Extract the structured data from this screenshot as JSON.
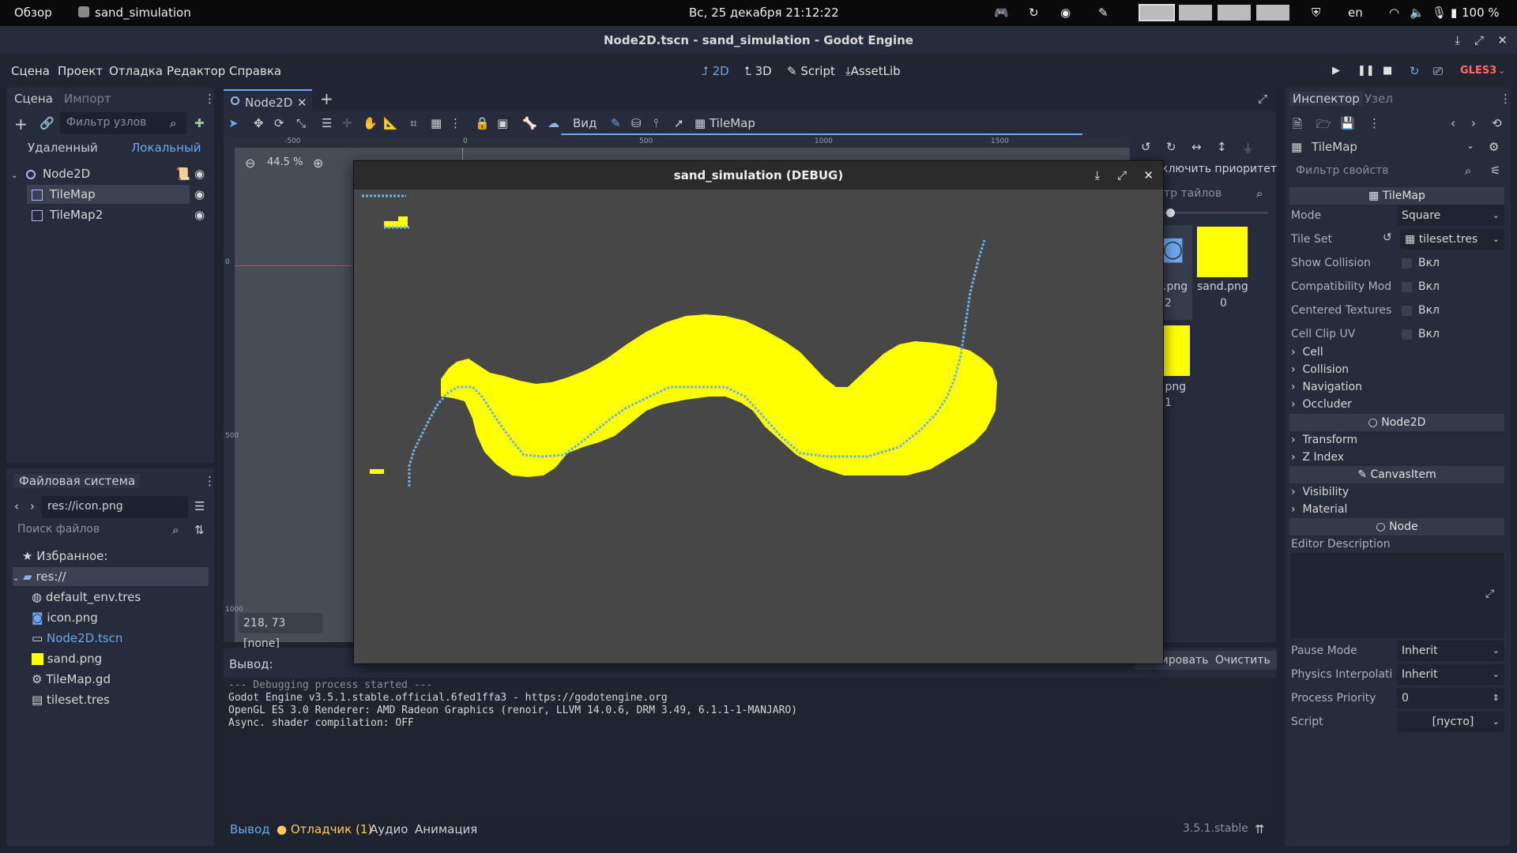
{
  "topbar": {
    "overview": "Обзор",
    "app_name": "sand_simulation",
    "datetime": "Вс, 25 декабря  21:12:22",
    "lang": "en",
    "battery": "100 %"
  },
  "window_title": "Node2D.tscn - sand_simulation - Godot Engine",
  "menu": {
    "items": [
      "Сцена",
      "Проект",
      "Отладка",
      "Редактор",
      "Справка"
    ],
    "modes": {
      "m2d": "2D",
      "m3d": "3D",
      "script": "Script",
      "assetlib": "AssetLib"
    },
    "renderer": "GLES3"
  },
  "scene_dock": {
    "tabs": {
      "scene": "Сцена",
      "import": "Импорт"
    },
    "filter_placeholder": "Фильтр узлов",
    "remote": "Удаленный",
    "local": "Локальный",
    "nodes": [
      "Node2D",
      "TileMap",
      "TileMap2"
    ]
  },
  "fs_dock": {
    "title": "Файловая система",
    "path": "res://icon.png",
    "search_placeholder": "Поиск файлов",
    "favorites": "Избранное:",
    "root": "res://",
    "files": [
      "default_env.tres",
      "icon.png",
      "Node2D.tscn",
      "sand.png",
      "TileMap.gd",
      "tileset.tres"
    ]
  },
  "editor": {
    "scene_tab": "Node2D",
    "zoom": "44.5 %",
    "view_menu": "Вид",
    "tilemap_label": "TileMap",
    "coords": "218, 73 [none]",
    "ruler_ticks": [
      "-500",
      "0",
      "500",
      "1000",
      "1500"
    ],
    "vruler_ticks": [
      "0",
      "500",
      "1000"
    ],
    "priority_label": "ключить приоритет",
    "tile_filter_placeholder": "тр тайлов",
    "tiles": [
      {
        "name": ".png",
        "idx": "2"
      },
      {
        "name": "sand.png",
        "idx": "0"
      },
      {
        "name": ".png",
        "idx": "1"
      }
    ]
  },
  "debug_window": {
    "title": "sand_simulation (DEBUG)"
  },
  "output": {
    "label": "Вывод:",
    "copy": "Копировать",
    "clear": "Очистить",
    "lines": [
      "--- Debugging process started ---",
      "Godot Engine v3.5.1.stable.official.6fed1ffa3 - https://godotengine.org",
      "OpenGL ES 3.0 Renderer: AMD Radeon Graphics (renoir, LLVM 14.0.6, DRM 3.49, 6.1.1-1-MANJARO)",
      "Async. shader compilation: OFF"
    ]
  },
  "bottom_tabs": {
    "output": "Вывод",
    "debugger": "Отладчик (1)",
    "audio": "Аудио",
    "animation": "Анимация",
    "version": "3.5.1.stable"
  },
  "inspector": {
    "tabs": {
      "inspector": "Инспектор",
      "node": "Узел"
    },
    "node_name": "TileMap",
    "filter_placeholder": "Фильтр свойств",
    "section_tilemap": "TileMap",
    "props": {
      "mode_label": "Mode",
      "mode_val": "Square",
      "tileset_label": "Tile Set",
      "tileset_val": "tileset.tres",
      "show_collision": "Show Collision",
      "compat": "Compatibility Mod",
      "centered": "Centered Textures",
      "clip": "Cell Clip UV",
      "on": "Вкл"
    },
    "groups1": [
      "Cell",
      "Collision",
      "Navigation",
      "Occluder"
    ],
    "section_node2d": "Node2D",
    "groups2": [
      "Transform",
      "Z Index"
    ],
    "section_canvas": "CanvasItem",
    "groups3": [
      "Visibility",
      "Material"
    ],
    "section_node": "Node",
    "editor_desc": "Editor Description",
    "pause_label": "Pause Mode",
    "pause_val": "Inherit",
    "phys_label": "Physics Interpolati",
    "phys_val": "Inherit",
    "prio_label": "Process Priority",
    "prio_val": "0",
    "script_label": "Script",
    "script_val": "[пусто]"
  },
  "colors": {
    "sand": "#ffff00",
    "accent": "#6aa8f0",
    "debug_bg": "#474747"
  }
}
